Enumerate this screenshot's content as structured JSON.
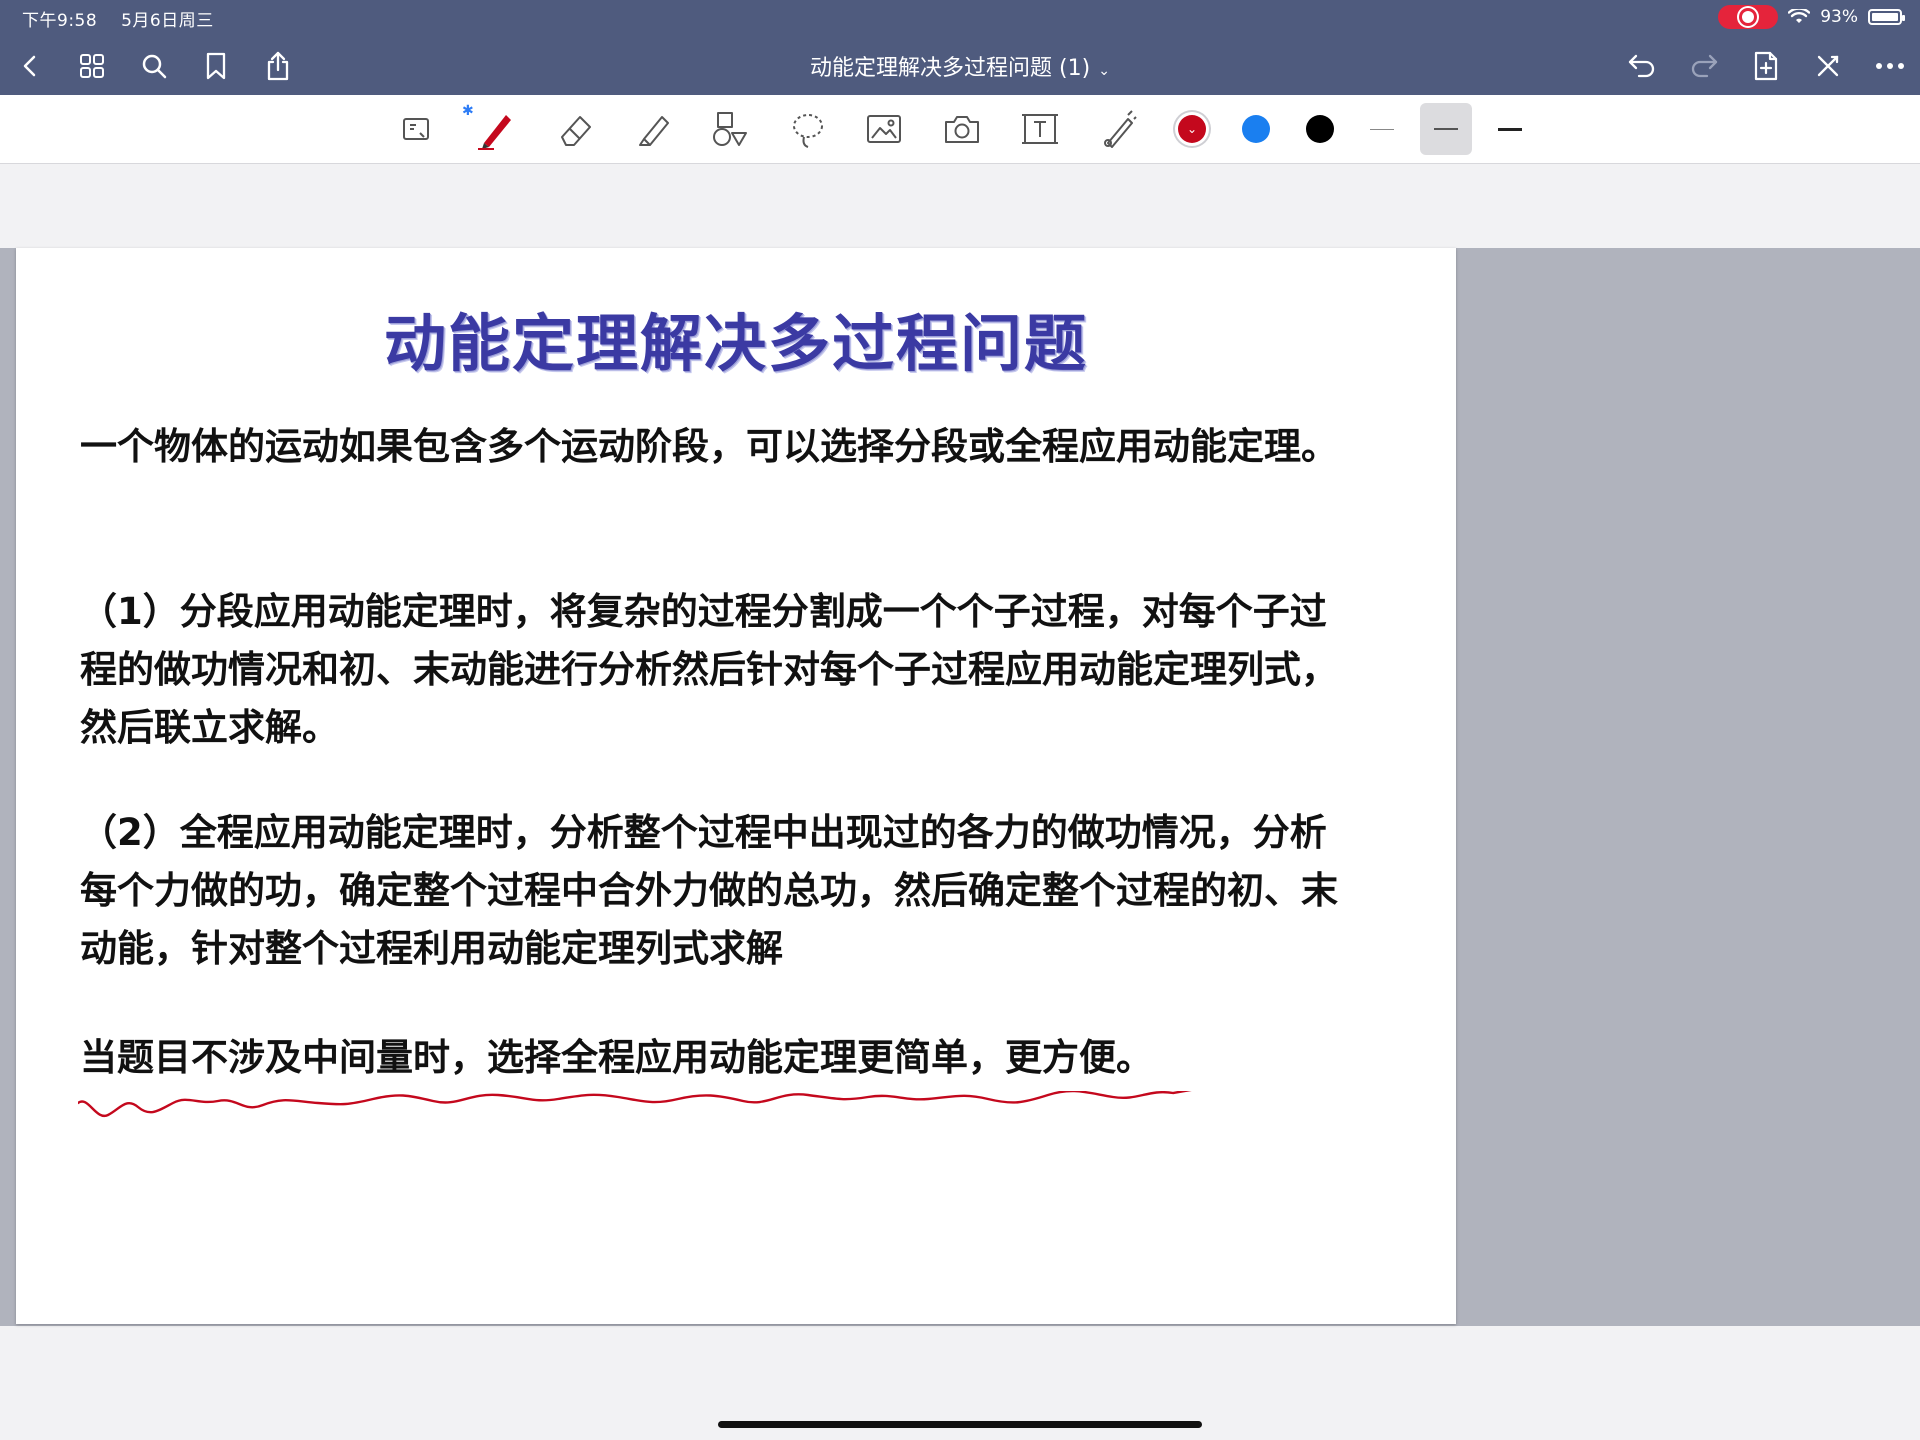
{
  "status": {
    "time": "下午9:58",
    "date": "5月6日周三",
    "battery": "93%"
  },
  "nav": {
    "doc_title": "动能定理解决多过程问题 (1)",
    "icons": [
      "back-chevron-icon",
      "grid-icon",
      "search-icon",
      "bookmark-icon",
      "share-icon",
      "undo-icon",
      "redo-icon",
      "add-page-icon",
      "close-icon",
      "more-icon"
    ]
  },
  "toolbar": {
    "tools": [
      "read-mode-icon",
      "pen-icon",
      "eraser-icon",
      "highlighter-icon",
      "shapes-icon",
      "lasso-icon",
      "image-icon",
      "camera-icon",
      "text-box-icon",
      "laser-pointer-icon"
    ],
    "colors": [
      "#c4081d",
      "#1a7ff0",
      "#000000"
    ],
    "selected_color": "#c4081d",
    "stroke_widths": [
      "thin",
      "medium",
      "thick"
    ],
    "selected_stroke": "medium"
  },
  "slide": {
    "title": "动能定理解决多过程问题",
    "p1": "一个物体的运动如果包含多个运动阶段，可以选择分段或全程应用动能定理。",
    "p2": "（1）分段应用动能定理时，将复杂的过程分割成一个个子过程，对每个子过程的做功情况和初、末动能进行分析然后针对每个子过程应用动能定理列式，然后联立求解。",
    "p3": "（2）全程应用动能定理时，分析整个过程中出现过的各力的做功情况，分析每个力做的功，确定整个过程中合外力做的总功，然后确定整个过程的初、末动能，针对整个过程利用动能定理列式求解",
    "p4": "当题目不涉及中间量时，选择全程应用动能定理更简单，更方便。"
  },
  "annotation": {
    "color": "#c4081d"
  }
}
